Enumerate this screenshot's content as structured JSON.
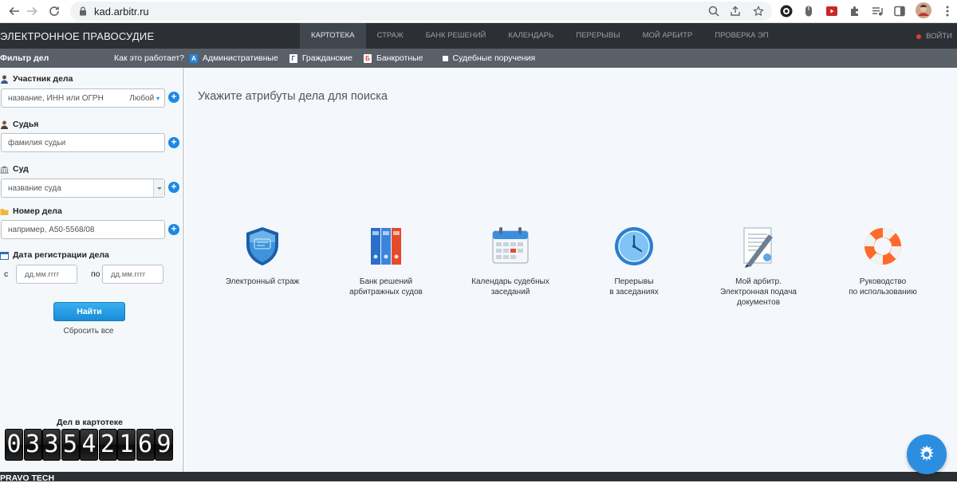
{
  "browser": {
    "url": "kad.arbitr.ru"
  },
  "site": {
    "title": "ЭЛЕКТРОННОЕ ПРАВОСУДИЕ",
    "nav": [
      "КАРТОТЕКА",
      "СТРАЖ",
      "БАНК РЕШЕНИЙ",
      "КАЛЕНДАРЬ",
      "ПЕРЕРЫВЫ",
      "МОЙ АРБИТР",
      "ПРОВЕРКА ЭП"
    ],
    "active_nav": "КАРТОТЕКА",
    "exit_label": "ВОЙТИ"
  },
  "filterbar": {
    "title": "Фильтр дел",
    "how": "Как это работает?",
    "types": [
      {
        "label": "Административные",
        "letter": "А",
        "color": "#1e88e5"
      },
      {
        "label": "Гражданские",
        "letter": "Г",
        "color": "#1565c0"
      },
      {
        "label": "Банкротные",
        "letter": "Б",
        "color": "#e53935"
      },
      {
        "label": "Судебные поручения",
        "letter": "",
        "color": "#ffffff"
      }
    ]
  },
  "filter": {
    "participant": {
      "label": "Участник дела",
      "placeholder": "название, ИНН или ОГРН",
      "scope": "Любой"
    },
    "judge": {
      "label": "Судья",
      "placeholder": "фамилия судьи"
    },
    "court": {
      "label": "Суд",
      "placeholder": "название суда"
    },
    "case_number": {
      "label": "Номер дела",
      "placeholder": "например, А50-5568/08"
    },
    "reg_date": {
      "label": "Дата регистрации дела",
      "from_label": "с",
      "to_label": "по",
      "from_placeholder": "дд.мм.гггг",
      "to_placeholder": "дд.мм.гггг"
    },
    "find_label": "Найти",
    "reset_label": "Сбросить все"
  },
  "counter": {
    "title": "Дел в картотеке",
    "digits": [
      "0",
      "3",
      "3",
      "5",
      "4",
      "2",
      "1",
      "6",
      "9"
    ]
  },
  "main": {
    "title": "Укажите атрибуты дела для поиска",
    "tiles": [
      {
        "icon": "shield-icon",
        "lines": [
          "Электронный страж"
        ]
      },
      {
        "icon": "binders-icon",
        "lines": [
          "Банк решений",
          "арбитражных судов"
        ]
      },
      {
        "icon": "calendar-icon",
        "lines": [
          "Календарь судебных",
          "заседаний"
        ]
      },
      {
        "icon": "clock-icon",
        "lines": [
          "Перерывы",
          "в заседаниях"
        ]
      },
      {
        "icon": "document-pen-icon",
        "lines": [
          "Мой арбитр.",
          "Электронная подача",
          "документов"
        ]
      },
      {
        "icon": "lifebuoy-icon",
        "lines": [
          "Руководство",
          "по использованию"
        ]
      }
    ]
  },
  "footer": {
    "brand": "PRAVO TECH"
  },
  "colors": {
    "topbar": "#2c3035",
    "filterbar": "#5a6068",
    "accent": "#1e88e5"
  }
}
